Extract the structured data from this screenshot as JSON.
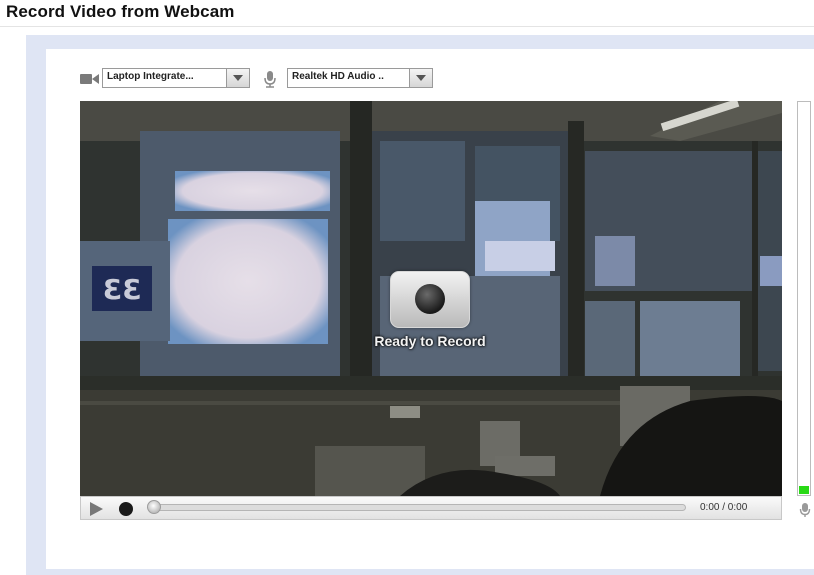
{
  "page": {
    "title": "Record Video from Webcam"
  },
  "devices": {
    "camera": {
      "selected": "Laptop Integrate...",
      "icon": "video-camera-icon"
    },
    "microphone": {
      "selected": "Realtek HD Audio ..",
      "icon": "microphone-icon"
    }
  },
  "video": {
    "status_text": "Ready to Record",
    "record_icon": "record-icon"
  },
  "controls": {
    "play_icon": "play-icon",
    "record_icon": "record-dot-icon",
    "time": "0:00 / 0:00",
    "progress_fraction": 0
  },
  "audio_level": {
    "level_fraction": 0.02,
    "fill_color": "#29d916",
    "icon": "microphone-icon"
  }
}
